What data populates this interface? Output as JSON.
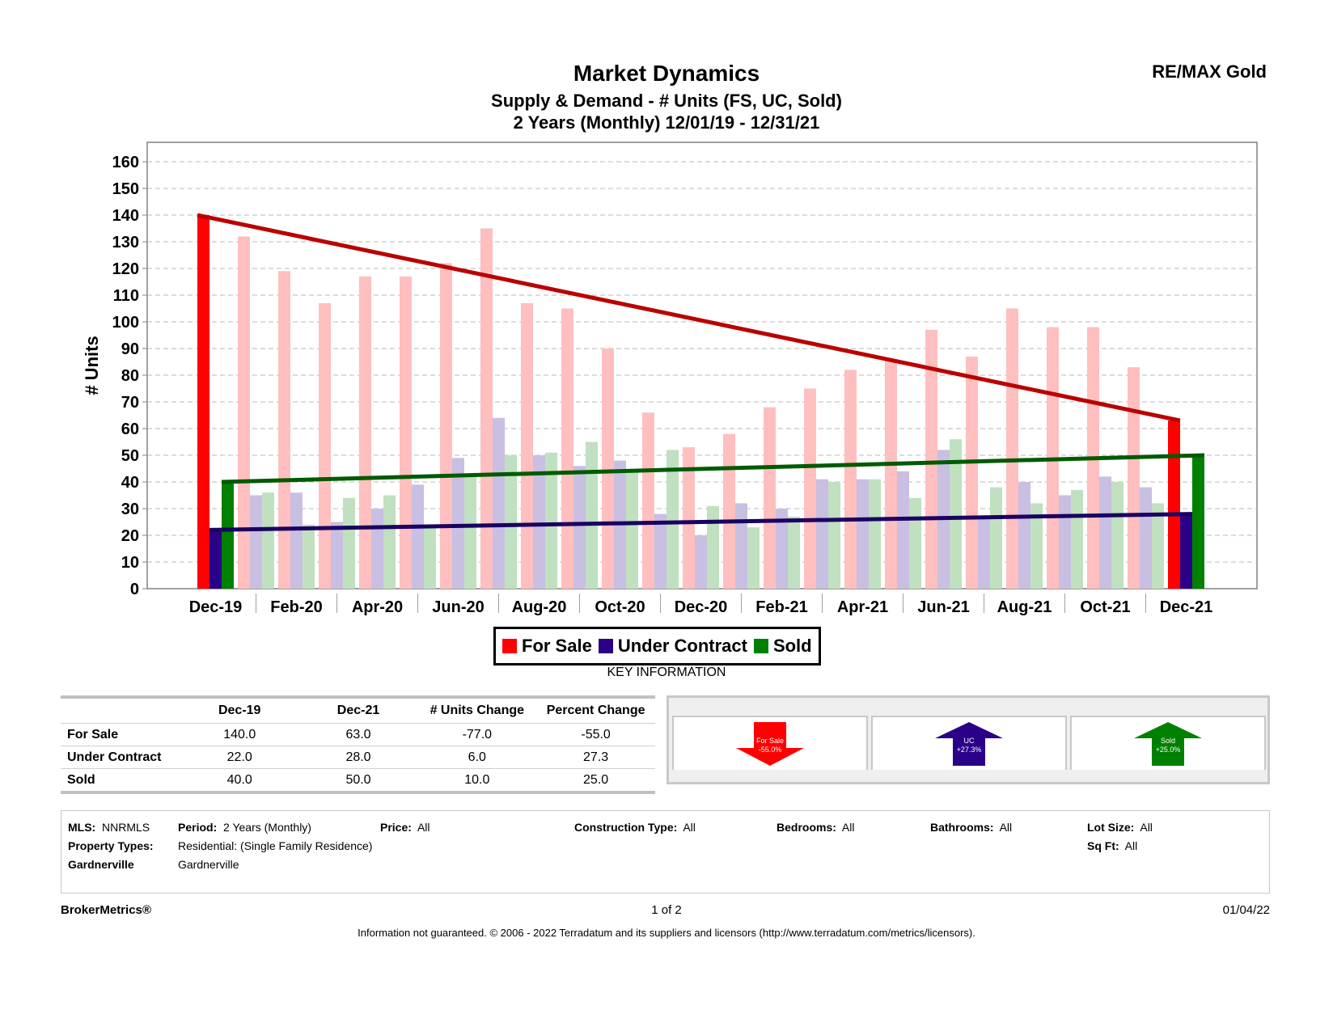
{
  "header": {
    "title": "Market Dynamics",
    "subtitle1": "Supply & Demand - # Units (FS, UC, Sold)",
    "subtitle2": "2 Years (Monthly) 12/01/19 - 12/31/21",
    "brand": "RE/MAX Gold"
  },
  "chart_data": {
    "type": "bar",
    "title": "Market Dynamics",
    "subtitle": "Supply & Demand - # Units (FS, UC, Sold)",
    "xlabel": "",
    "ylabel": "# Units",
    "ylim": [
      0,
      160
    ],
    "yticks": [
      0,
      10,
      20,
      30,
      40,
      50,
      60,
      70,
      80,
      90,
      100,
      110,
      120,
      130,
      140,
      150,
      160
    ],
    "grid": true,
    "legend_position": "bottom-center",
    "categories": [
      "Dec-19",
      "Jan-20",
      "Feb-20",
      "Mar-20",
      "Apr-20",
      "May-20",
      "Jun-20",
      "Jul-20",
      "Aug-20",
      "Sep-20",
      "Oct-20",
      "Nov-20",
      "Dec-20",
      "Jan-21",
      "Feb-21",
      "Mar-21",
      "Apr-21",
      "May-21",
      "Jun-21",
      "Jul-21",
      "Aug-21",
      "Sep-21",
      "Oct-21",
      "Nov-21",
      "Dec-21"
    ],
    "x_tick_labels": [
      "Dec-19",
      "Feb-20",
      "Apr-20",
      "Jun-20",
      "Aug-20",
      "Oct-20",
      "Dec-20",
      "Feb-21",
      "Apr-21",
      "Jun-21",
      "Aug-21",
      "Oct-21",
      "Dec-21"
    ],
    "series": [
      {
        "name": "For Sale",
        "color": "#ff0000",
        "light_color": "#ffbfbf",
        "trend_color": "#bb0000",
        "values": [
          140,
          132,
          119,
          107,
          117,
          117,
          122,
          135,
          107,
          105,
          90,
          66,
          53,
          58,
          68,
          75,
          82,
          86,
          97,
          87,
          105,
          98,
          98,
          83,
          63
        ],
        "trend": [
          140,
          63
        ]
      },
      {
        "name": "Under Contract",
        "color": "#2a0088",
        "light_color": "#c8bfe2",
        "trend_color": "#1a0060",
        "values": [
          22,
          35,
          36,
          25,
          30,
          39,
          49,
          64,
          50,
          46,
          48,
          28,
          20,
          32,
          30,
          41,
          41,
          44,
          52,
          27,
          40,
          35,
          42,
          38,
          28
        ],
        "trend": [
          22,
          28
        ]
      },
      {
        "name": "Sold",
        "color": "#008000",
        "light_color": "#c0e0c0",
        "trend_color": "#005a00",
        "values": [
          40,
          36,
          24,
          34,
          35,
          23,
          42,
          50,
          51,
          55,
          44,
          52,
          31,
          23,
          27,
          40,
          41,
          34,
          56,
          38,
          32,
          37,
          40,
          32,
          50
        ],
        "trend": [
          40,
          50
        ]
      }
    ]
  },
  "legend": [
    {
      "label": "For Sale",
      "color": "#ff0000"
    },
    {
      "label": "Under Contract",
      "color": "#2a0088"
    },
    {
      "label": "Sold",
      "color": "#008000"
    }
  ],
  "key_info": {
    "title": "KEY INFORMATION",
    "columns": [
      "",
      "Dec-19",
      "Dec-21",
      "# Units Change",
      "Percent Change"
    ],
    "rows": [
      {
        "label": "For Sale",
        "dec19": "140.0",
        "dec21": "63.0",
        "units_change": "-77.0",
        "pct_change": "-55.0"
      },
      {
        "label": "Under Contract",
        "dec19": "22.0",
        "dec21": "28.0",
        "units_change": "6.0",
        "pct_change": "27.3"
      },
      {
        "label": "Sold",
        "dec19": "40.0",
        "dec21": "50.0",
        "units_change": "10.0",
        "pct_change": "25.0"
      }
    ],
    "arrows": [
      {
        "line1": "For Sale",
        "line2": "-55.0%",
        "direction": "down",
        "color": "#ff0000"
      },
      {
        "line1": "UC",
        "line2": "+27.3%",
        "direction": "up",
        "color": "#2a0088"
      },
      {
        "line1": "Sold",
        "line2": "+25.0%",
        "direction": "up",
        "color": "#008000"
      }
    ]
  },
  "filters": {
    "mls_label": "MLS:",
    "mls": "NNRMLS",
    "period_label": "Period:",
    "period": "2 Years (Monthly)",
    "price_label": "Price:",
    "price": "All",
    "construction_label": "Construction Type:",
    "construction": "All",
    "bedrooms_label": "Bedrooms:",
    "bedrooms": "All",
    "bathrooms_label": "Bathrooms:",
    "bathrooms": "All",
    "lotsize_label": "Lot Size:",
    "lotsize": "All",
    "sqft_label": "Sq Ft:",
    "sqft": "All",
    "property_types_label": "Property Types:",
    "property_types": "Residential: (Single Family Residence)",
    "area_label": "Gardnerville",
    "area": "Gardnerville"
  },
  "footer": {
    "brand": "BrokerMetrics®",
    "page": "1 of 2",
    "date": "01/04/22",
    "disclaimer": "Information not guaranteed.  © 2006 - 2022 Terradatum and its suppliers and licensors (http://www.terradatum.com/metrics/licensors)."
  }
}
